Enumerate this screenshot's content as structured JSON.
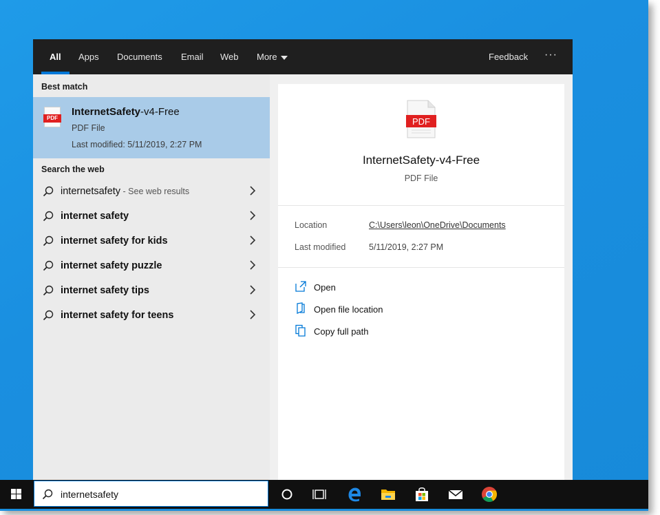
{
  "tabs": [
    {
      "label": "All"
    },
    {
      "label": "Apps"
    },
    {
      "label": "Documents"
    },
    {
      "label": "Email"
    },
    {
      "label": "Web"
    },
    {
      "label": "More"
    }
  ],
  "header": {
    "feedback": "Feedback",
    "more_options": "···"
  },
  "best_match": {
    "section_label": "Best match",
    "icon_text": "PDF",
    "title_bold": "InternetSafety",
    "title_rest": "-v4-Free",
    "type": "PDF File",
    "modified": "Last modified: 5/11/2019, 2:27 PM"
  },
  "web": {
    "section_label": "Search the web",
    "first": {
      "query": "internetsafety",
      "suffix": " - See web results"
    },
    "suggestions": [
      "internet safety",
      "internet safety for kids",
      "internet safety puzzle",
      "internet safety tips",
      "internet safety for teens"
    ]
  },
  "preview": {
    "icon_text": "PDF",
    "title": "InternetSafety-v4-Free",
    "type": "PDF File",
    "location_label": "Location",
    "location_value": "C:\\Users\\leon\\OneDrive\\Documents",
    "modified_label": "Last modified",
    "modified_value": "5/11/2019, 2:27 PM",
    "actions": [
      "Open",
      "Open file location",
      "Copy full path"
    ]
  },
  "taskbar": {
    "search_value": "internetsafety",
    "icons": [
      "cortana-icon",
      "task-view-icon",
      "edge-icon",
      "file-explorer-icon",
      "store-icon",
      "mail-icon",
      "chrome-icon"
    ]
  },
  "colors": {
    "accent": "#0078d7",
    "selection": "#a9cbe8",
    "pdf_red": "#e02020",
    "desktop": "#1a8fe0"
  }
}
